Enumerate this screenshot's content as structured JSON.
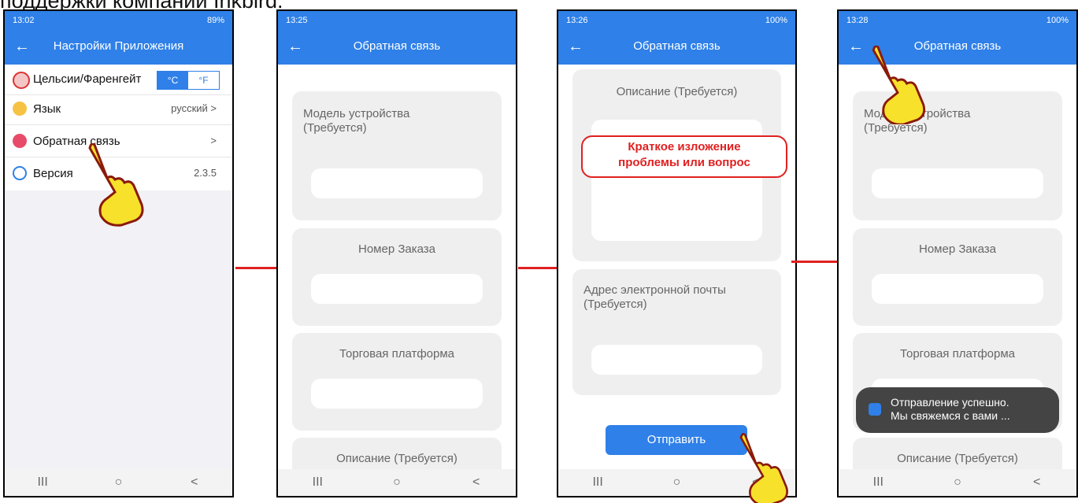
{
  "page": {
    "title_fragment": "поддержки компании Inkbird."
  },
  "screen1": {
    "status_time": "13:02",
    "status_right": "89%",
    "app_title": "Настройки Приложения",
    "rows": [
      {
        "label": "Цельсии/Фаренгейт",
        "value": ""
      },
      {
        "label": "Язык",
        "value": "русский >"
      },
      {
        "label": "Обратная связь",
        "value": ">"
      },
      {
        "label": "Версия",
        "value": "2.3.5"
      }
    ],
    "unit_c": "°C",
    "unit_f": "°F",
    "colors": {
      "accent": "#2f80e8"
    }
  },
  "screen2": {
    "status_time": "13:25",
    "status_right": "",
    "app_title": "Обратная связь",
    "cards": [
      {
        "label": "Модель устройства\n(Требуется)"
      },
      {
        "label": "Номер Заказа"
      },
      {
        "label": "Торговая платформа"
      },
      {
        "label": "Описание (Требуется)"
      }
    ]
  },
  "screen3": {
    "status_time": "13:26",
    "status_right": "100%",
    "app_title": "Обратная связь",
    "description_label": "Описание (Требуется)",
    "callout_line1": "Краткое изложение",
    "callout_line2": "проблемы или вопрос",
    "email_label": "Адрес электронной почты\n(Требуется)",
    "send_label": "Отправить"
  },
  "screen4": {
    "status_time": "13:28",
    "status_right": "100%",
    "app_title": "Обратная связь",
    "cards": [
      {
        "label": "Модель устройства\n(Требуется)"
      },
      {
        "label": "Номер Заказа"
      },
      {
        "label": "Торговая платформа"
      },
      {
        "label": "Описание (Требуется)"
      }
    ],
    "toast_line1": "Отправление успешно.",
    "toast_line2": "Мы свяжемся с вами ..."
  },
  "nav": {
    "recent": "III",
    "home": "○",
    "back": "<"
  }
}
